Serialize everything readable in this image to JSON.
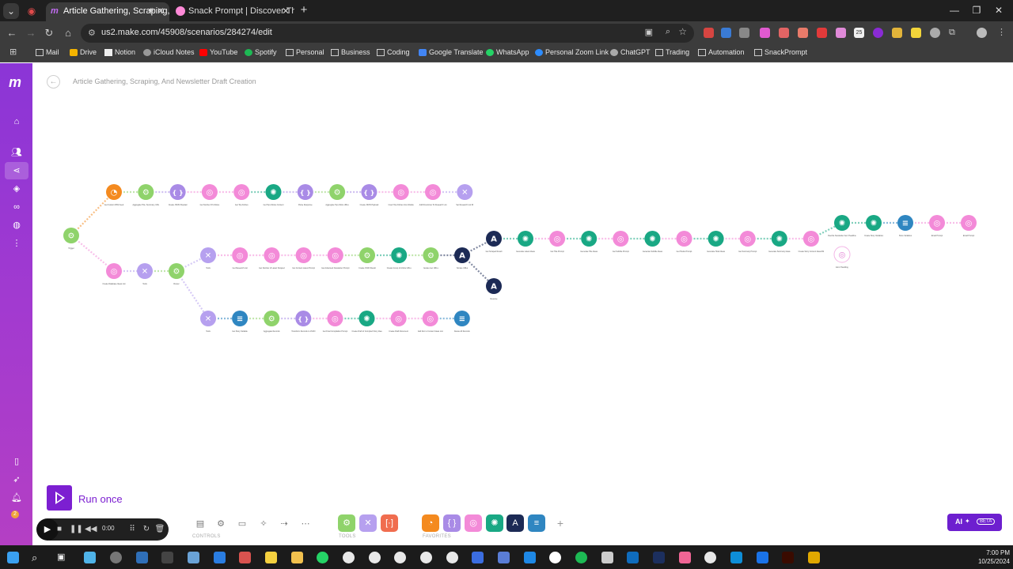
{
  "browser": {
    "tabs": [
      {
        "title": "Article Gathering, Scraping,",
        "active": true
      },
      {
        "title": "Snack Prompt | Discover The Be",
        "active": false
      }
    ],
    "url": "us2.make.com/45908/scenarios/284274/edit",
    "bookmarks": [
      "Mail",
      "Drive",
      "Notion",
      "iCloud Notes",
      "YouTube",
      "Spotify",
      "Personal",
      "Business",
      "Coding",
      "Google Translate",
      "WhatsApp",
      "Personal Zoom Link",
      "ChatGPT",
      "Trading",
      "Automation",
      "SnackPrompt"
    ],
    "extension_badge": "25"
  },
  "app": {
    "scenario_title": "Article Gathering, Scraping, And Newsletter Draft Creation",
    "run_button_label": "Run once",
    "toolbar_sections": {
      "controls": "CONTROLS",
      "tools": "TOOLS",
      "favorites": "FAVORITES"
    },
    "ai_button": {
      "label": "AI",
      "badge": "BETA"
    },
    "notification_count": "2",
    "colors": {
      "accent": "#7c1fd1",
      "sidebar": "#a23ad0",
      "rss": "#f48a1f",
      "json": "#a98be6",
      "http": "#f38ad8",
      "openai": "#19a884",
      "router": "#b6a0ef",
      "tools": "#8fd36b",
      "datastore": "#2f86c1",
      "anthropic": "#1c2a55"
    }
  },
  "scenario_nodes": [
    {
      "id": "trigger",
      "label": "Trigger",
      "kind": "tools-icon"
    },
    {
      "id": "n1",
      "label": "Get Custom RSS Feed",
      "kind": "rss-icon"
    },
    {
      "id": "n2",
      "label": "Aggregate Title, Summary, URL",
      "kind": "tools-icon"
    },
    {
      "id": "n3",
      "label": "Create JSON Payload",
      "kind": "json-icon"
    },
    {
      "id": "n4",
      "label": "Get Number Of Articles",
      "kind": "http-icon"
    },
    {
      "id": "n5",
      "label": "Get Top Articles",
      "kind": "http-icon"
    },
    {
      "id": "n6",
      "label": "Get Top Articles Content",
      "kind": "openai-icon"
    },
    {
      "id": "n7",
      "label": "Parse Response",
      "kind": "json-icon"
    },
    {
      "id": "n8",
      "label": "Aggregate Top Article URLs",
      "kind": "tools-icon"
    },
    {
      "id": "n9",
      "label": "Create JSON Payload",
      "kind": "json-icon"
    },
    {
      "id": "n10",
      "label": "Insert Top Articles Into Airtable",
      "kind": "http-icon"
    },
    {
      "id": "n11",
      "label": "Add Directories To Research List",
      "kind": "http-icon"
    },
    {
      "id": "n12",
      "label": "Set Research List ID",
      "kind": "router-icon"
    },
    {
      "id": "m1",
      "label": "Create Database Ideas List",
      "kind": "http-icon"
    },
    {
      "id": "m2",
      "label": "Tools",
      "kind": "router-icon"
    },
    {
      "id": "m3",
      "label": "Router",
      "kind": "tools-icon"
    },
    {
      "id": "m4",
      "label": "Tools",
      "kind": "router-icon"
    },
    {
      "id": "m5",
      "label": "Get Research List",
      "kind": "http-icon"
    },
    {
      "id": "m6",
      "label": "Get Number of Latest Scraped",
      "kind": "http-icon"
    },
    {
      "id": "m7",
      "label": "Get Content Latest Prompt",
      "kind": "http-icon"
    },
    {
      "id": "m8",
      "label": "Get Advanced Newsletter Prompt",
      "kind": "http-icon"
    },
    {
      "id": "m9",
      "label": "Create JSON Result",
      "kind": "tools-icon"
    },
    {
      "id": "m10",
      "label": "Create Group of Article URLs",
      "kind": "openai-icon"
    },
    {
      "id": "m11",
      "label": "Iterate over URLs",
      "kind": "tools-icon"
    },
    {
      "id": "m12",
      "label": "Scrape URLs",
      "kind": "anthropic-icon"
    },
    {
      "id": "a1",
      "label": "Get Scraped Result",
      "kind": "anthropic-icon"
    },
    {
      "id": "a2",
      "label": "Generate Latest Ideas",
      "kind": "openai-icon"
    },
    {
      "id": "a3",
      "label": "Get Title Prompt",
      "kind": "http-icon"
    },
    {
      "id": "a4",
      "label": "Generate Title Ideas",
      "kind": "openai-icon"
    },
    {
      "id": "a5",
      "label": "Get Subtitle Prompt",
      "kind": "http-icon"
    },
    {
      "id": "a6",
      "label": "Generate Subtitle Ideas",
      "kind": "openai-icon"
    },
    {
      "id": "a7",
      "label": "Get Hooks Prompt",
      "kind": "http-icon"
    },
    {
      "id": "a8",
      "label": "Generate Hook Ideas",
      "kind": "openai-icon"
    },
    {
      "id": "a9",
      "label": "Get Summary Prompt",
      "kind": "http-icon"
    },
    {
      "id": "a10",
      "label": "Generate Summary Ideas",
      "kind": "openai-icon"
    },
    {
      "id": "a11",
      "label": "Create Story Content Ideas Bit",
      "kind": "http-icon"
    },
    {
      "id": "a12",
      "label": "Error Handling",
      "kind": "http-icon"
    },
    {
      "id": "b1",
      "label": "Rewrite Newsletter Item Headline",
      "kind": "openai-icon"
    },
    {
      "id": "b2",
      "label": "Create Story Variables",
      "kind": "openai-icon"
    },
    {
      "id": "b3",
      "label": "Store Variables",
      "kind": "datastore-icon"
    },
    {
      "id": "b4",
      "label": "Email Prompt",
      "kind": "http-icon"
    },
    {
      "id": "b5",
      "label": "Email Prompt",
      "kind": "http-icon"
    },
    {
      "id": "c1",
      "label": "Resume",
      "kind": "anthropic-icon"
    },
    {
      "id": "d1",
      "label": "Tools",
      "kind": "router-icon"
    },
    {
      "id": "d2",
      "label": "Get Story Variable",
      "kind": "datastore-icon"
    },
    {
      "id": "d3",
      "label": "Aggregate Records",
      "kind": "tools-icon"
    },
    {
      "id": "d4",
      "label": "Transform Records to JSON",
      "kind": "json-icon"
    },
    {
      "id": "d5",
      "label": "Get Final Compilation Prompt",
      "kind": "http-icon"
    },
    {
      "id": "d6",
      "label": "Create Draft of Compiled Story Idea",
      "kind": "openai-icon"
    },
    {
      "id": "d7",
      "label": "Create Draft Document",
      "kind": "http-icon"
    },
    {
      "id": "d8",
      "label": "Add Doc to Content Ideas List",
      "kind": "http-icon"
    },
    {
      "id": "d9",
      "label": "Delete All Records",
      "kind": "datastore-icon"
    }
  ],
  "taskbar": {
    "time": "7:00 PM",
    "date": "10/25/2024"
  }
}
